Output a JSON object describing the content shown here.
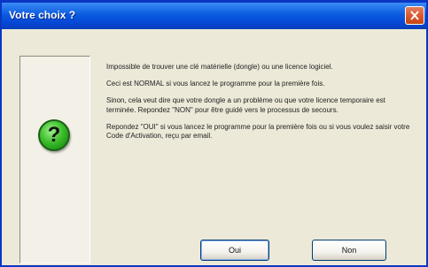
{
  "window": {
    "title": "Votre choix ?"
  },
  "icon": {
    "name": "question-icon",
    "glyph": "?",
    "color": "#2aa51f"
  },
  "message": {
    "paragraphs": [
      "Impossible de trouver une clé matérielle (dongle) ou une licence logiciel.",
      "Ceci est NORMAL si vous lancez le programme pour la première fois.",
      "Sinon, cela veut dire que votre dongle a un problème ou que votre licence temporaire est terminée. Repondez \"NON\" pour être guidé vers le processus de secours.",
      "Repondez \"OUI\" si vous lancez le programme pour la première fois ou si vous voulez saisir votre Code d'Activation, reçu par email."
    ]
  },
  "buttons": {
    "yes_label": "Oui",
    "no_label": "Non"
  },
  "colors": {
    "titlebar": "#0a5be0",
    "close": "#d9572d",
    "dialog_bg": "#ece9d8"
  }
}
